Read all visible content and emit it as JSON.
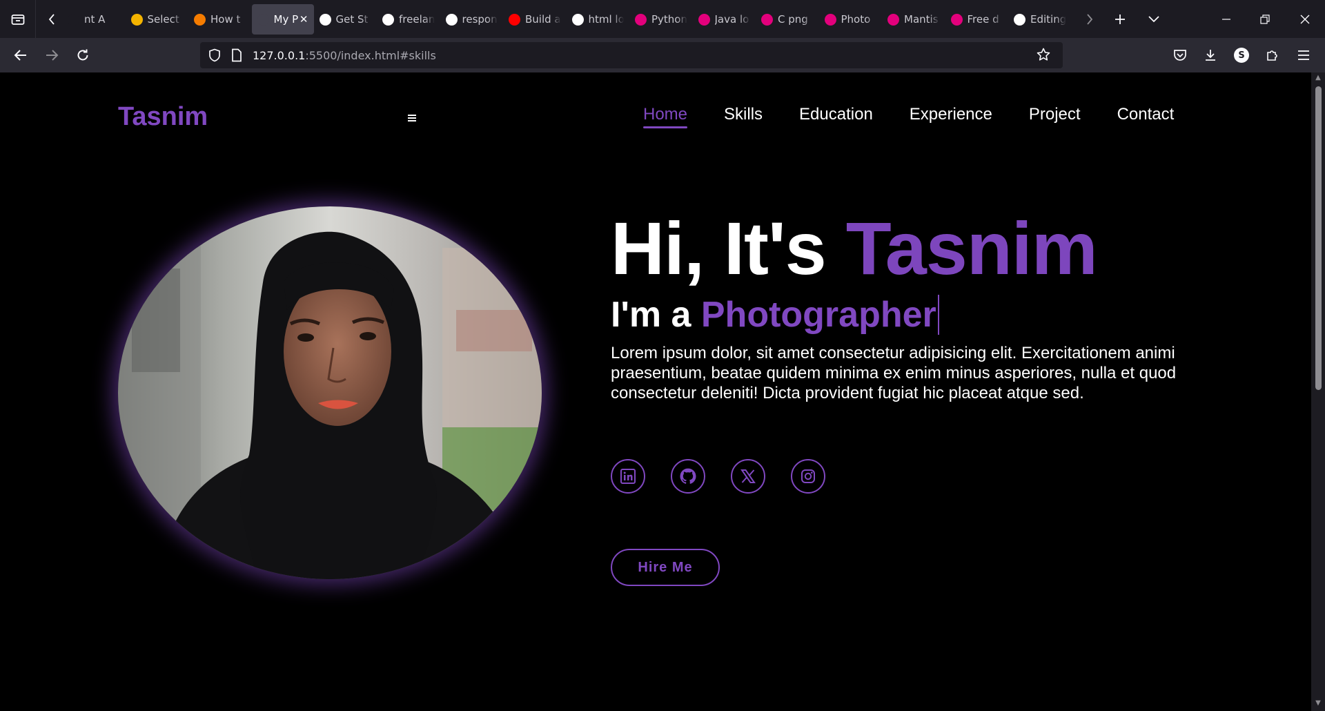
{
  "browser": {
    "tabs": [
      {
        "title": "nt A",
        "favicon_color": "#1c1b22"
      },
      {
        "title": "Select",
        "favicon_color": "#f4b400"
      },
      {
        "title": "How t",
        "favicon_color": "#f57c00"
      },
      {
        "title": "My Port",
        "favicon_color": "#42414d",
        "active": true
      },
      {
        "title": "Get St",
        "favicon_color": "#ffffff"
      },
      {
        "title": "freelan",
        "favicon_color": "#ffffff"
      },
      {
        "title": "respon",
        "favicon_color": "#ffffff"
      },
      {
        "title": "Build a",
        "favicon_color": "#ff0000"
      },
      {
        "title": "html lo",
        "favicon_color": "#ffffff"
      },
      {
        "title": "Python",
        "favicon_color": "#e3007c"
      },
      {
        "title": "Java lo",
        "favicon_color": "#e3007c"
      },
      {
        "title": "C png",
        "favicon_color": "#e3007c"
      },
      {
        "title": "Photo",
        "favicon_color": "#e3007c"
      },
      {
        "title": "Mantis",
        "favicon_color": "#e3007c"
      },
      {
        "title": "Free d",
        "favicon_color": "#e3007c"
      },
      {
        "title": "Editing",
        "favicon_color": "#ffffff"
      }
    ],
    "url_host": "127.0.0.1",
    "url_rest": ":5500/index.html#skills",
    "profile_initial": "S"
  },
  "site": {
    "logo": "Tasnim",
    "nav": [
      "Home",
      "Skills",
      "Education",
      "Experience",
      "Project",
      "Contact"
    ],
    "active_nav": "Home",
    "hero": {
      "greeting": "Hi, It's",
      "name": "Tasnim",
      "role_prefix": "I'm a",
      "role": "Photographer",
      "description": "Lorem ipsum dolor, sit amet consectetur adipisicing elit. Exercitationem animi praesentium, beatae quidem minima ex enim minus asperiores, nulla et quod consectetur deleniti! Dicta provident fugiat hic placeat atque sed.",
      "button": "Hire Me"
    },
    "socials": [
      "linkedin-icon",
      "github-icon",
      "x-icon",
      "instagram-icon"
    ],
    "colors": {
      "accent": "#8048c1",
      "background": "#000000",
      "text": "#ffffff"
    }
  }
}
